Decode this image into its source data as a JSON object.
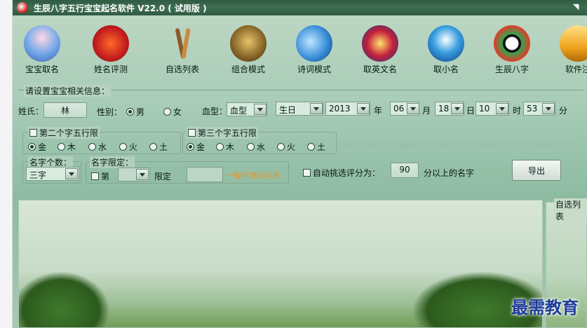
{
  "title": "生辰八字五行宝宝起名软件 V22.0 ( 试用版 )",
  "toolbar": [
    {
      "label": "宝宝取名",
      "icon": "baby-icon"
    },
    {
      "label": "姓名评测",
      "icon": "evaluate-icon"
    },
    {
      "label": "自选列表",
      "icon": "brush-list-icon"
    },
    {
      "label": "组合模式",
      "icon": "lion-icon"
    },
    {
      "label": "诗词模式",
      "icon": "book-icon"
    },
    {
      "label": "取英文名",
      "icon": "badge-icon"
    },
    {
      "label": "取小名",
      "icon": "penguin-icon"
    },
    {
      "label": "生辰八字",
      "icon": "bagua-icon"
    },
    {
      "label": "软件注",
      "icon": "lock-icon"
    }
  ],
  "settings": {
    "section_title": "请设置宝宝相关信息：",
    "surname_label": "姓氏：",
    "surname_value": "林",
    "gender_label": "性别：",
    "gender_male": "男",
    "gender_female": "女",
    "blood_label": "血型：",
    "blood_value": "血型",
    "birth_label": "生日",
    "year_value": "2013",
    "year_unit": "年",
    "month_value": "06",
    "month_unit": "月",
    "day_value": "18",
    "day_unit": "日",
    "hour_value": "10",
    "hour_unit": "时",
    "minute_value": "53",
    "minute_unit": "分"
  },
  "second_char": {
    "title": "第二个字五行限",
    "options": [
      "金",
      "木",
      "水",
      "火",
      "土"
    ]
  },
  "third_char": {
    "title": "第三个字五行限",
    "options": [
      "金",
      "木",
      "水",
      "火",
      "土"
    ]
  },
  "hint": "说明：五行限定 选择后名字中的该字 必须属于该五行，不选则不限",
  "name_count": {
    "title": "名字个数：",
    "value": "三字"
  },
  "name_limit": {
    "title": "名字限定：",
    "prefix": "第",
    "suffix": "限定",
    "note": "一般不建议勾选"
  },
  "auto": {
    "label": "自动挑选评分为：",
    "score": "90",
    "suffix": "分以上的名字"
  },
  "export_label": "导出",
  "list_title": "自选列表",
  "watermark": "最需教育"
}
